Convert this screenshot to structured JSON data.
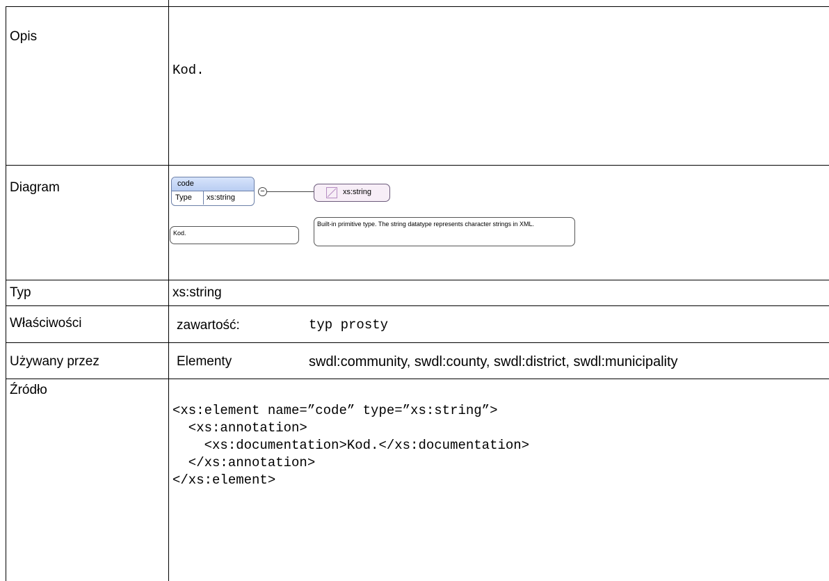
{
  "rows": {
    "opis": {
      "label": "Opis",
      "value": "Kod."
    },
    "diagram": {
      "label": "Diagram"
    },
    "typ": {
      "label": "Typ",
      "value": "xs:string"
    },
    "wlasciwosci": {
      "label": "Właściwości",
      "key": "zawartość:",
      "value": "typ prosty"
    },
    "uzywany": {
      "label": "Używany przez",
      "key": "Elementy",
      "value": "swdl:community, swdl:county, swdl:district, swdl:municipality"
    },
    "zrodlo": {
      "label": "Źródło",
      "code": "<xs:element name=”code” type=”xs:string”>\n  <xs:annotation>\n    <xs:documentation>Kod.</xs:documentation>\n  </xs:annotation>\n</xs:element>"
    }
  },
  "diagram": {
    "element_name": "code",
    "type_label": "Type",
    "type_value": "xs:string",
    "element_doc": "Kod.",
    "type_name": "xs:string",
    "type_doc": "Built-in primitive type. The string datatype represents character strings in XML."
  },
  "colors": {
    "border": "#000000",
    "element_header": "#c5d7f5",
    "type_fill": "#f7eef7"
  }
}
